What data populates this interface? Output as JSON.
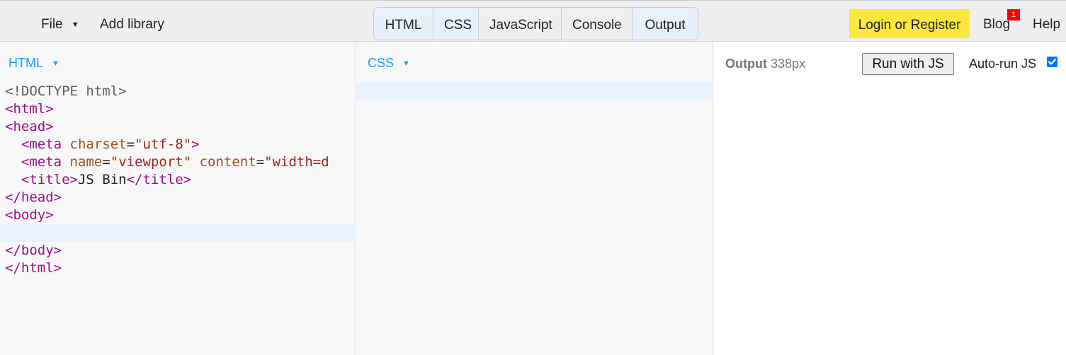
{
  "topbar": {
    "file_label": "File",
    "file_caret": "▼",
    "add_library_label": "Add library",
    "tabs": [
      {
        "label": "HTML",
        "active": true
      },
      {
        "label": "CSS",
        "active": true
      },
      {
        "label": "JavaScript",
        "active": false
      },
      {
        "label": "Console",
        "active": false
      },
      {
        "label": "Output",
        "active": true
      }
    ],
    "login_label": "Login or Register",
    "blog_label": "Blog",
    "blog_badge": "1",
    "help_label": "Help"
  },
  "html_panel": {
    "label": "HTML",
    "caret": "▼"
  },
  "css_panel": {
    "label": "CSS",
    "caret": "▼"
  },
  "output_panel": {
    "label_bold": "Output",
    "width_text": "338px",
    "run_button_label": "Run with JS",
    "autorun_label": "Auto-run JS",
    "autorun_checked": true
  },
  "colors": {
    "accent": "#1ea1e0",
    "login_bg": "#fde73c",
    "badge_bg": "#ff0000",
    "checkbox": "#0075ff",
    "tag": "#990f87",
    "attribute": "#a0521d",
    "string": "#a8201b"
  },
  "icons": [
    "caret-down-icon",
    "checkbox-checked-icon",
    "notification-badge"
  ]
}
